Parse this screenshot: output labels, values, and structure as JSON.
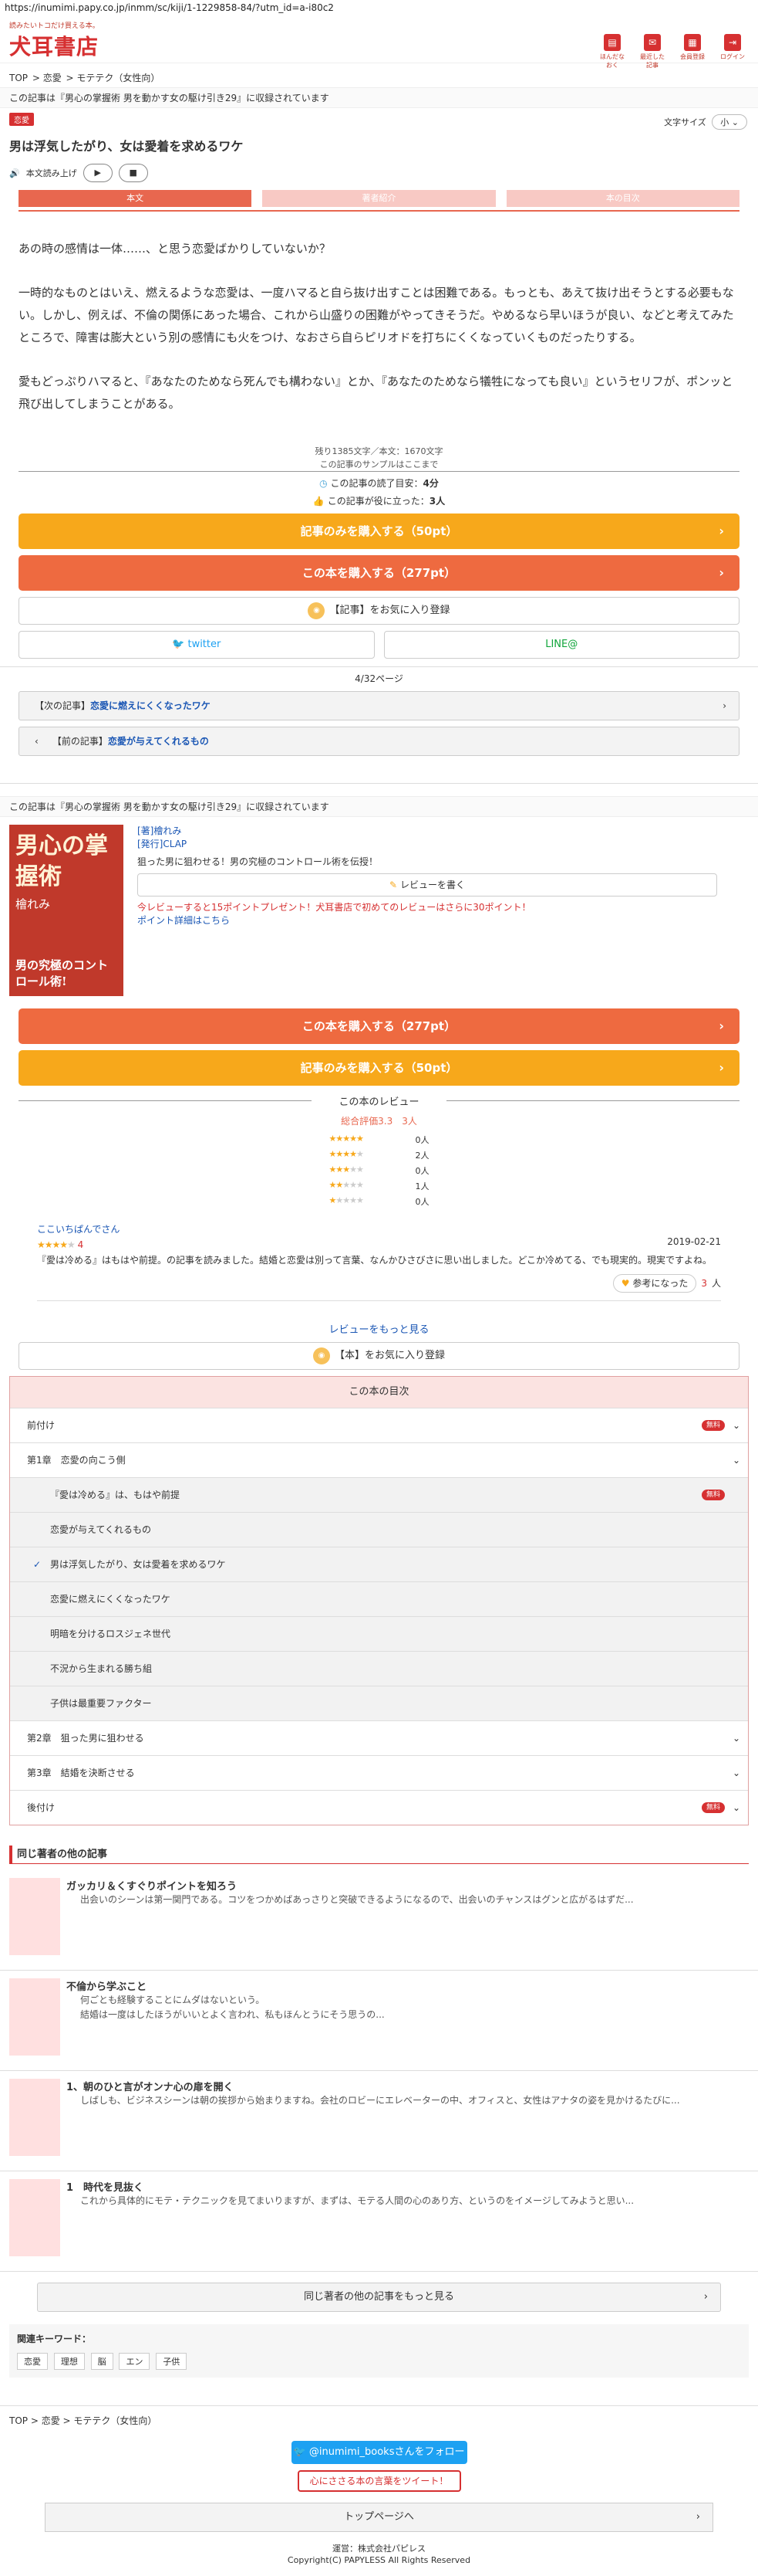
{
  "url": "https://inumimi.papy.co.jp/inmm/sc/kiji/1-1229858-84/?utm_id=a-i80c2",
  "header": {
    "tagline": "読みたいトコだけ買える本。",
    "logo": "犬耳書店",
    "icons": [
      {
        "name": "read-later-icon",
        "label": "ほんだなおく"
      },
      {
        "name": "read-history-icon",
        "label": "最近した記事"
      },
      {
        "name": "register-icon",
        "label": "会員登録"
      },
      {
        "name": "login-icon",
        "label": "ログイン"
      }
    ]
  },
  "breadcrumb": [
    "TOP",
    "恋愛",
    "モテテク（女性向）"
  ],
  "included_in": "この記事は『男心の掌握術 男を動かす女の駆け引き29』に収録されています",
  "category_badge": "恋愛",
  "font_size_label": "文字サイズ",
  "font_size_value": "小",
  "title": "男は浮気したがり、女は愛着を求めるワケ",
  "tts_label": "本文読み上げ",
  "tabs": [
    "本文",
    "著者紹介",
    "本の目次"
  ],
  "article": [
    "あの時の感情は一体……、と思う恋愛ばかりしていないか？",
    "一時的なものとはいえ、燃えるような恋愛は、一度ハマると自ら抜け出すことは困難である。もっとも、あえて抜け出そうとする必要もない。しかし、例えば、不倫の関係にあった場合、これから山盛りの困難がやってきそうだ。やめるなら早いほうが良い、などと考えてみたところで、障害は膨大という別の感情にも火をつけ、なおさら自らピリオドを打ちにくくなっていくものだったりする。",
    "愛もどっぷりハマると、『あなたのためなら死んでも構わない』とか、『あなたのためなら犠牲になっても良い』というセリフが、ポンッと飛び出してしまうことがある。"
  ],
  "stats": {
    "remaining": "残り1385文字／本文：1670文字",
    "sample_end": "この記事のサンプルはここまで",
    "read_time_label": "この記事の読了目安：",
    "read_time": "4分",
    "helpful_label": "この記事が役に立った：",
    "helpful_count": "3人"
  },
  "buttons": {
    "buy_article": "記事のみを購入する（50pt）",
    "buy_book": "この本を購入する（277pt）",
    "fav_article": "【記事】をお気に入り登録",
    "twitter": "twitter",
    "line": "LINE@",
    "fav_book": "【本】をお気に入り登録",
    "more_reviews": "レビューをもっと見る",
    "more_other": "同じ著者の他の記事をもっと見る",
    "follow": "@inumimi_booksさんをフォロー",
    "tweet_quote": "心にささる本の言葉をツイート！",
    "top_page": "トップページへ"
  },
  "page_count": "4/32ページ",
  "next_article": {
    "label": "【次の記事】",
    "title": "恋愛に燃えにくくなったワケ"
  },
  "prev_article": {
    "label": "【前の記事】",
    "title": "恋愛が与えてくれるもの"
  },
  "book": {
    "cover_title": "男心の掌握術",
    "cover_author": "檜れみ",
    "cover_bottom": "男の究極のコントロール術!",
    "author": "[著]檜れみ",
    "publisher": "[発行]CLAP",
    "desc": "狙った男に狙わせる！男の究極のコントロール術を伝授！",
    "write_review": "レビューを書く",
    "review_promo": "今レビューすると15ポイントプレゼント！犬耳書店で初めてのレビューはさらに30ポイント！",
    "point_link": "ポイント詳細はこちら"
  },
  "reviews": {
    "heading": "この本のレビュー",
    "avg": "総合評価3.3　3人",
    "distribution": [
      {
        "stars": 5,
        "count": "0人"
      },
      {
        "stars": 4,
        "count": "2人"
      },
      {
        "stars": 3,
        "count": "0人"
      },
      {
        "stars": 2,
        "count": "1人"
      },
      {
        "stars": 1,
        "count": "0人"
      }
    ],
    "item": {
      "user": "ここいちぱんでさん",
      "rating": "4",
      "date": "2019-02-21",
      "body": "『愛は冷める』はもはや前提。の記事を読みました。結婚と恋愛は別って言葉、なんかひさびさに思い出しました。どこか冷めてる、でも現実的。現実ですよね。",
      "helpful_btn": "参考になった",
      "helpful_count": "3",
      "helpful_unit": "人"
    }
  },
  "toc": {
    "heading": "この本の目次",
    "rows": [
      {
        "label": "前付け",
        "type": "chapter",
        "free": "無料"
      },
      {
        "label": "第1章　恋愛の向こう側",
        "type": "chapter",
        "free": ""
      },
      {
        "label": "『愛は冷める』は、もはや前提",
        "type": "sub",
        "free": "無料"
      },
      {
        "label": "恋愛が与えてくれるもの",
        "type": "sub",
        "free": ""
      },
      {
        "label": "男は浮気したがり、女は愛着を求めるワケ",
        "type": "current",
        "free": ""
      },
      {
        "label": "恋愛に燃えにくくなったワケ",
        "type": "sub",
        "free": ""
      },
      {
        "label": "明暗を分けるロスジェネ世代",
        "type": "sub",
        "free": ""
      },
      {
        "label": "不況から生まれる勝ち組",
        "type": "sub",
        "free": ""
      },
      {
        "label": "子供は最重要ファクター",
        "type": "sub",
        "free": ""
      },
      {
        "label": "第2章　狙った男に狙わせる",
        "type": "chapter",
        "free": ""
      },
      {
        "label": "第3章　結婚を決断させる",
        "type": "chapter",
        "free": ""
      },
      {
        "label": "後付け",
        "type": "chapter",
        "free": "無料"
      }
    ]
  },
  "other_articles": {
    "heading": "同じ著者の他の記事",
    "items": [
      {
        "title": "ガッカリ＆くすぐりポイントを知ろう",
        "desc": "出会いのシーンは第一関門である。コツをつかめばあっさりと突破できるようになるので、出会いのチャンスはグンと広がるはずだ..."
      },
      {
        "title": "不倫から学ぶこと",
        "desc": "何ごとも経験することにムダはないという。\n結婚は一度はしたほうがいいとよく言われ、私もほんとうにそう思うの..."
      },
      {
        "title": "1、朝のひと言がオンナ心の扉を開く",
        "desc": "しばしも、ビジネスシーンは朝の挨拶から始まりますね。会社のロビーにエレベーターの中、オフィスと、女性はアナタの姿を見かけるたびに..."
      },
      {
        "title": "1　時代を見抜く",
        "desc": "これから具体的にモテ・テクニックを見てまいりますが、まずは、モテる人間の心のあり方、というのをイメージしてみようと思い..."
      }
    ]
  },
  "keywords": {
    "label": "関連キーワード：",
    "items": [
      "恋愛",
      "理想",
      "脳",
      "エン",
      "子供"
    ]
  },
  "footer": {
    "breadcrumb": [
      "TOP",
      "恋愛",
      "モテテク（女性向）"
    ],
    "operator": "運営：株式会社パピレス",
    "copyright": "Copyright(C) PAPYLESS All Rights Reserved"
  }
}
